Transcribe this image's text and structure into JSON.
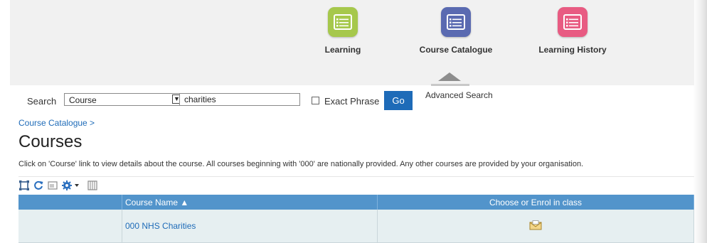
{
  "apps": [
    {
      "label": "Learning",
      "icon": "list-icon",
      "color": "#a6c84c"
    },
    {
      "label": "Course Catalogue",
      "icon": "list-icon",
      "color": "#5a6ab1"
    },
    {
      "label": "Learning History",
      "icon": "list-icon",
      "color": "#e85b82"
    }
  ],
  "search": {
    "label": "Search",
    "type_value": "Course",
    "query_value": "charities",
    "exact_phrase_label": "Exact Phrase",
    "go_label": "Go",
    "advanced_label": "Advanced Search"
  },
  "breadcrumb": "Course Catalogue >",
  "page_title": "Courses",
  "instructions": "Click on 'Course' link to view details about the course. All courses beginning with '000' are nationally provided. Any other courses are provided by your organisation.",
  "toolbar_icons": [
    "expand-icon",
    "refresh-icon",
    "export-icon",
    "settings-icon",
    "columns-icon"
  ],
  "table": {
    "columns": [
      "",
      "Course Name ▲",
      "Choose or Enrol in class"
    ],
    "rows": [
      {
        "col0": "",
        "course_name": "000 NHS Charities",
        "enrol_icon": "enrol-envelope-icon"
      }
    ]
  },
  "colors": {
    "accent": "#1e6bb8",
    "table_header": "#5294cb",
    "row_bg": "#e6eff1"
  }
}
